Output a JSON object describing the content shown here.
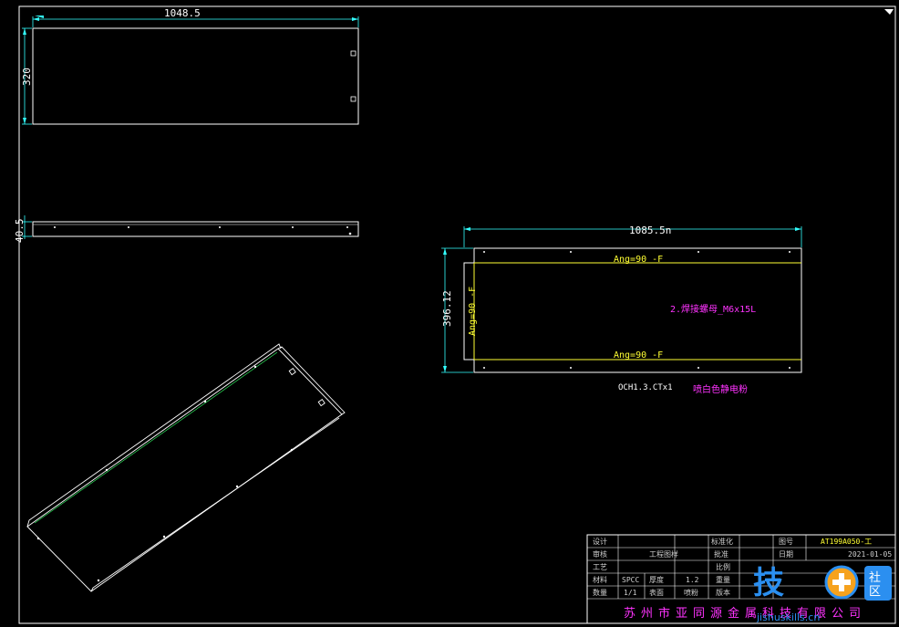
{
  "drawing": {
    "top_view": {
      "width_dim": "1048.5",
      "height_dim": "320"
    },
    "side_view": {
      "height_dim": "40.5"
    },
    "flat_pattern": {
      "width_dim": "1085.5n",
      "height_dim": "396.12",
      "bend_top": "Ang=90 -F",
      "bend_bottom": "Ang=90 -F",
      "bend_left": "Ang=90 -F",
      "note_weld": "2.焊接螺母_M6x15L",
      "material": "OCH1.3.CTx1",
      "note_finish": "喷白色静电粉"
    }
  },
  "title_block": {
    "cells": [
      "设计",
      "",
      "",
      "",
      "标准化",
      "",
      "图号",
      "AT199A050-工"
    ],
    "row2": [
      "审核",
      "",
      "工程图样",
      "",
      "批准",
      "",
      "日期",
      "2021-01-05"
    ],
    "row3": [
      "工艺",
      "",
      "",
      "",
      "比例",
      "",
      "",
      ""
    ],
    "row4": [
      "材料",
      "SPCC",
      "厚度",
      "1.2",
      "重量",
      "",
      "",
      ""
    ],
    "row5": [
      "数量",
      "1/1",
      "表面",
      "喷粉",
      "版本",
      "",
      "",
      ""
    ],
    "company": "苏州市亚同源金属科技有限公司"
  },
  "watermark": {
    "brand": "技",
    "badge": "社区",
    "site": "jishuskills.cn"
  }
}
